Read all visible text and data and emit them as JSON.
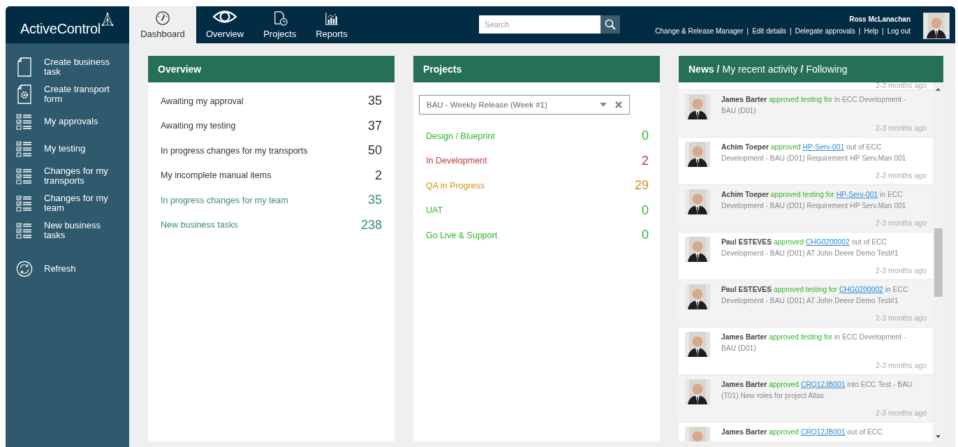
{
  "header": {
    "logo": "ActiveControl",
    "tabs": [
      {
        "label": "Dashboard",
        "selected": true
      },
      {
        "label": "Overview",
        "selected": false
      },
      {
        "label": "Projects",
        "selected": false
      },
      {
        "label": "Reports",
        "selected": false
      }
    ],
    "search": {
      "placeholder": "Search"
    },
    "user": {
      "name": "Ross McLanachan",
      "role": "Change & Release Manager",
      "links": [
        {
          "separator": "|",
          "label": "Edit details"
        },
        {
          "separator": "|",
          "label": "Delegate approvals"
        },
        {
          "separator": "|",
          "label": "Help"
        },
        {
          "separator": "|",
          "label": "Log out"
        }
      ]
    }
  },
  "sidebar": {
    "items": [
      {
        "label": "Create business task"
      },
      {
        "label": "Create transport form"
      },
      {
        "label": "My approvals"
      },
      {
        "label": "My testing"
      },
      {
        "label": "Changes for my transports"
      },
      {
        "label": "Changes for my team"
      },
      {
        "label": "New business tasks"
      },
      {
        "label": "Refresh"
      }
    ]
  },
  "overview": {
    "title": "Overview",
    "rows": [
      {
        "label": "Awaiting my approval",
        "count": "35",
        "color": "#333333"
      },
      {
        "label": "Awaiting my testing",
        "count": "37",
        "color": "#333333"
      },
      {
        "label": "In progress changes for my transports",
        "count": "50",
        "color": "#333333"
      },
      {
        "label": "My incomplete manual items",
        "count": "2",
        "color": "#333333"
      },
      {
        "label": "In progress changes for my team",
        "count": "35",
        "color": "#3d8c73"
      },
      {
        "label": "New business tasks",
        "count": "238",
        "color": "#3d8c73"
      }
    ]
  },
  "projects": {
    "title": "Projects",
    "select": {
      "value": "BAU - Weekly Release (Week #1)"
    },
    "rows": [
      {
        "label": "Design / Blueprint",
        "count": "0",
        "color": "#2db52d"
      },
      {
        "label": "In Development",
        "count": "2",
        "color": "#c0393b"
      },
      {
        "label": "QA in Progress",
        "count": "29",
        "color": "#d4901c"
      },
      {
        "label": "UAT",
        "count": "0",
        "color": "#2db52d"
      },
      {
        "label": "Go Live & Support",
        "count": "0",
        "color": "#2db52d"
      }
    ]
  },
  "news": {
    "header": [
      {
        "kind": "tab",
        "text": "News",
        "selected": true
      },
      {
        "kind": "sep",
        "text": "/"
      },
      {
        "kind": "tab",
        "text": "My recent activity",
        "selected": false
      },
      {
        "kind": "sep",
        "text": "/"
      },
      {
        "kind": "tab",
        "text": "Following",
        "selected": false
      }
    ],
    "items": [
      {
        "time": "2-3 months ago"
      },
      {
        "name": "James Barter",
        "action": "approved testing for",
        "rest": "in ECC Development - BAU (D01)",
        "time": "2-3 months ago"
      },
      {
        "name": "Achim Toeper",
        "action": "approved",
        "link": "HP-Serv-001",
        "rest": "out of ECC Development - BAU (D01) Requirement HP Serv.Man 001",
        "time": "2-3 months ago"
      },
      {
        "name": "Achim Toeper",
        "action": "approved testing for",
        "link": "HP-Serv-001",
        "rest": "in ECC Development - BAU (D01) Requirement HP Serv.Man 001",
        "time": "2-3 months ago"
      },
      {
        "name": "Paul ESTEVES",
        "action": "approved",
        "link": "CHG0200002",
        "rest": "out of ECC Development - BAU (D01) AT John Deere Demo Test#1",
        "time": "2-3 months ago"
      },
      {
        "name": "Paul ESTEVES",
        "action": "approved testing for",
        "link": "CHG0200002",
        "rest": "in ECC Development - BAU (D01) AT John Deere Demo Test#1",
        "time": "2-3 months ago"
      },
      {
        "name": "James Barter",
        "action": "approved testing for",
        "rest": "in ECC Development - BAU (D01)",
        "time": "2-3 months ago"
      },
      {
        "name": "James Barter",
        "action": "approved",
        "link": "CRQ12JB001",
        "rest": "into ECC Test - BAU (T01) New roles for project Atlas",
        "time": "2-3 months ago"
      },
      {
        "name": "James Barter",
        "action": "approved",
        "link": "CRQ12JB001",
        "rest": "out of ECC"
      }
    ]
  }
}
